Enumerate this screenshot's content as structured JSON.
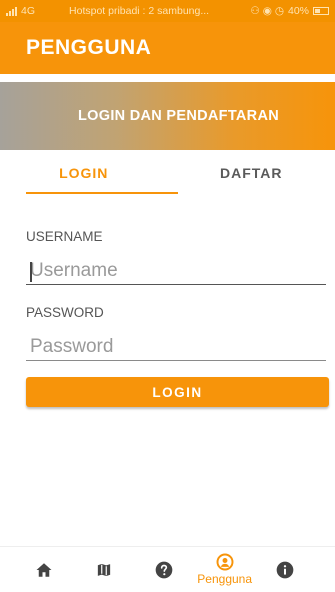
{
  "status_bar": {
    "network": "4G",
    "hotspot_text": "Hotspot pribadi : 2 sambung...",
    "battery": "40%"
  },
  "app_bar": {
    "title": "PENGGUNA"
  },
  "banner": {
    "text": "LOGIN DAN PENDAFTARAN"
  },
  "tabs": [
    {
      "label": "LOGIN",
      "active": true
    },
    {
      "label": "DAFTAR",
      "active": false
    }
  ],
  "form": {
    "username_label": "USERNAME",
    "username_placeholder": "Username",
    "password_label": "PASSWORD",
    "password_placeholder": "Password",
    "submit_label": "LOGIN"
  },
  "bottom_nav": {
    "items": [
      {
        "icon": "home-icon",
        "label": "",
        "active": false
      },
      {
        "icon": "map-icon",
        "label": "",
        "active": false
      },
      {
        "icon": "help-icon",
        "label": "",
        "active": false
      },
      {
        "icon": "user-icon",
        "label": "Pengguna",
        "active": true
      },
      {
        "icon": "info-icon",
        "label": "",
        "active": false
      }
    ]
  },
  "colors": {
    "accent": "#f7940a",
    "inactive_icon": "#444444",
    "text_muted": "#555555"
  }
}
